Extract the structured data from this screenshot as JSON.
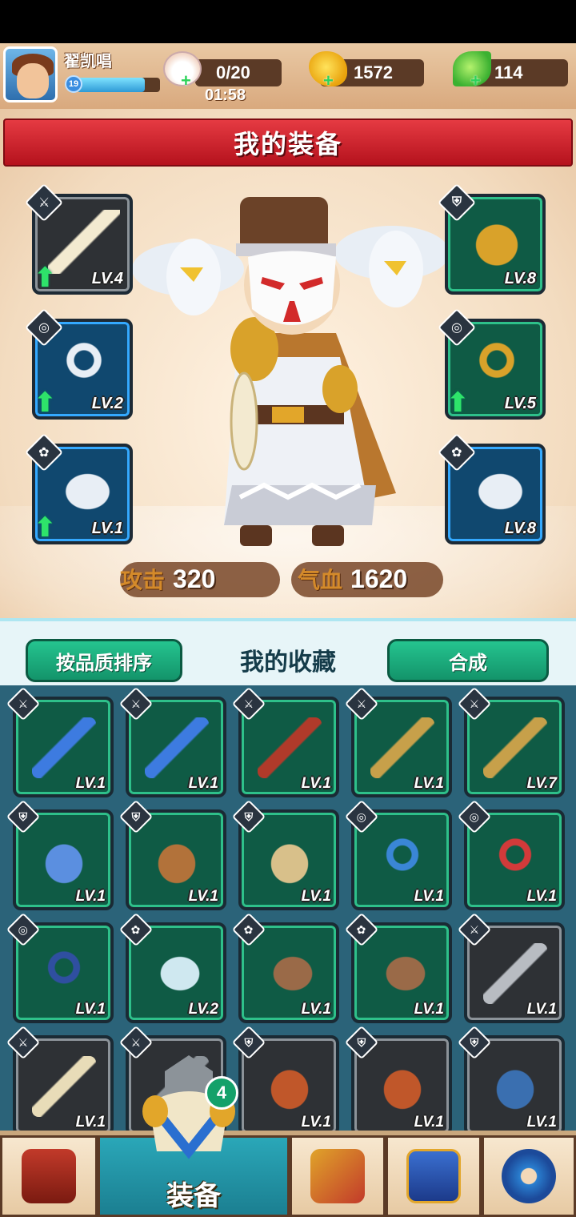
{
  "player": {
    "name": "翟凯唱",
    "level": "19",
    "xp_fraction": 0.82
  },
  "resources": {
    "stamina": "0/20",
    "stamina_timer": "01:58",
    "gold": "1572",
    "jade": "114"
  },
  "equip_panel": {
    "title": "我的装备",
    "left_slots": [
      {
        "level": "LV.4",
        "type": "sword",
        "rarity": "gray",
        "upgrade": true,
        "art": "fan"
      },
      {
        "level": "LV.2",
        "type": "ring",
        "rarity": "blue",
        "upgrade": true,
        "art": "pendant"
      },
      {
        "level": "LV.1",
        "type": "paw",
        "rarity": "blue",
        "upgrade": true,
        "art": "eagle"
      }
    ],
    "right_slots": [
      {
        "level": "LV.8",
        "type": "armor",
        "rarity": "green",
        "upgrade": false,
        "art": "armor"
      },
      {
        "level": "LV.5",
        "type": "ring",
        "rarity": "green",
        "upgrade": true,
        "art": "jade-ring"
      },
      {
        "level": "LV.8",
        "type": "paw",
        "rarity": "blue",
        "upgrade": false,
        "art": "eagle"
      }
    ],
    "attack_label": "攻击",
    "attack_value": "320",
    "hp_label": "气血",
    "hp_value": "1620"
  },
  "collection": {
    "sort_button": "按品质排序",
    "title": "我的收藏",
    "compose_button": "合成",
    "items": [
      {
        "level": "LV.1",
        "type": "sword",
        "rarity": "green",
        "color": "#3d7be0"
      },
      {
        "level": "LV.1",
        "type": "sword",
        "rarity": "green",
        "color": "#3d7be0"
      },
      {
        "level": "LV.1",
        "type": "sword",
        "rarity": "green",
        "color": "#b03a2a"
      },
      {
        "level": "LV.1",
        "type": "sword",
        "rarity": "green",
        "color": "#c7a04a"
      },
      {
        "level": "LV.7",
        "type": "sword",
        "rarity": "green",
        "color": "#c7a04a"
      },
      {
        "level": "LV.1",
        "type": "armor",
        "rarity": "green",
        "color": "#5b8fe0"
      },
      {
        "level": "LV.1",
        "type": "armor",
        "rarity": "green",
        "color": "#b2723a"
      },
      {
        "level": "LV.1",
        "type": "armor",
        "rarity": "green",
        "color": "#d8c08a"
      },
      {
        "level": "LV.1",
        "type": "ring",
        "rarity": "green",
        "color": "#3a86d6"
      },
      {
        "level": "LV.1",
        "type": "ring",
        "rarity": "green",
        "color": "#d23a3a"
      },
      {
        "level": "LV.1",
        "type": "ring",
        "rarity": "green",
        "color": "#2f4fa0"
      },
      {
        "level": "LV.2",
        "type": "paw",
        "rarity": "green",
        "color": "#cfe8f0"
      },
      {
        "level": "LV.1",
        "type": "paw",
        "rarity": "green",
        "color": "#9a6a48"
      },
      {
        "level": "LV.1",
        "type": "paw",
        "rarity": "green",
        "color": "#9a6a48"
      },
      {
        "level": "LV.1",
        "type": "sword",
        "rarity": "gray",
        "color": "#b8bcc2"
      },
      {
        "level": "LV.1",
        "type": "sword",
        "rarity": "gray",
        "color": "#e8dcb8"
      },
      {
        "level": "LV.1",
        "type": "sword",
        "rarity": "gray",
        "color": "#8c9399"
      },
      {
        "level": "LV.1",
        "type": "armor",
        "rarity": "gray",
        "color": "#c0572a"
      },
      {
        "level": "LV.1",
        "type": "armor",
        "rarity": "gray",
        "color": "#c0572a"
      },
      {
        "level": "LV.1",
        "type": "armor",
        "rarity": "gray",
        "color": "#3a6fb0"
      }
    ]
  },
  "nav": {
    "tabs": [
      {
        "name": "shop",
        "icon": "shop-icon"
      },
      {
        "name": "equipment",
        "icon": "armor-icon",
        "label": "装备",
        "badge": "4",
        "active": true
      },
      {
        "name": "skills",
        "icon": "weapon-icon"
      },
      {
        "name": "book",
        "icon": "book-icon"
      },
      {
        "name": "settings",
        "icon": "gear-icon"
      }
    ]
  },
  "colors": {
    "accent_red": "#c8202c",
    "accent_green": "#1aa878",
    "panel_teal": "#2b6379"
  }
}
